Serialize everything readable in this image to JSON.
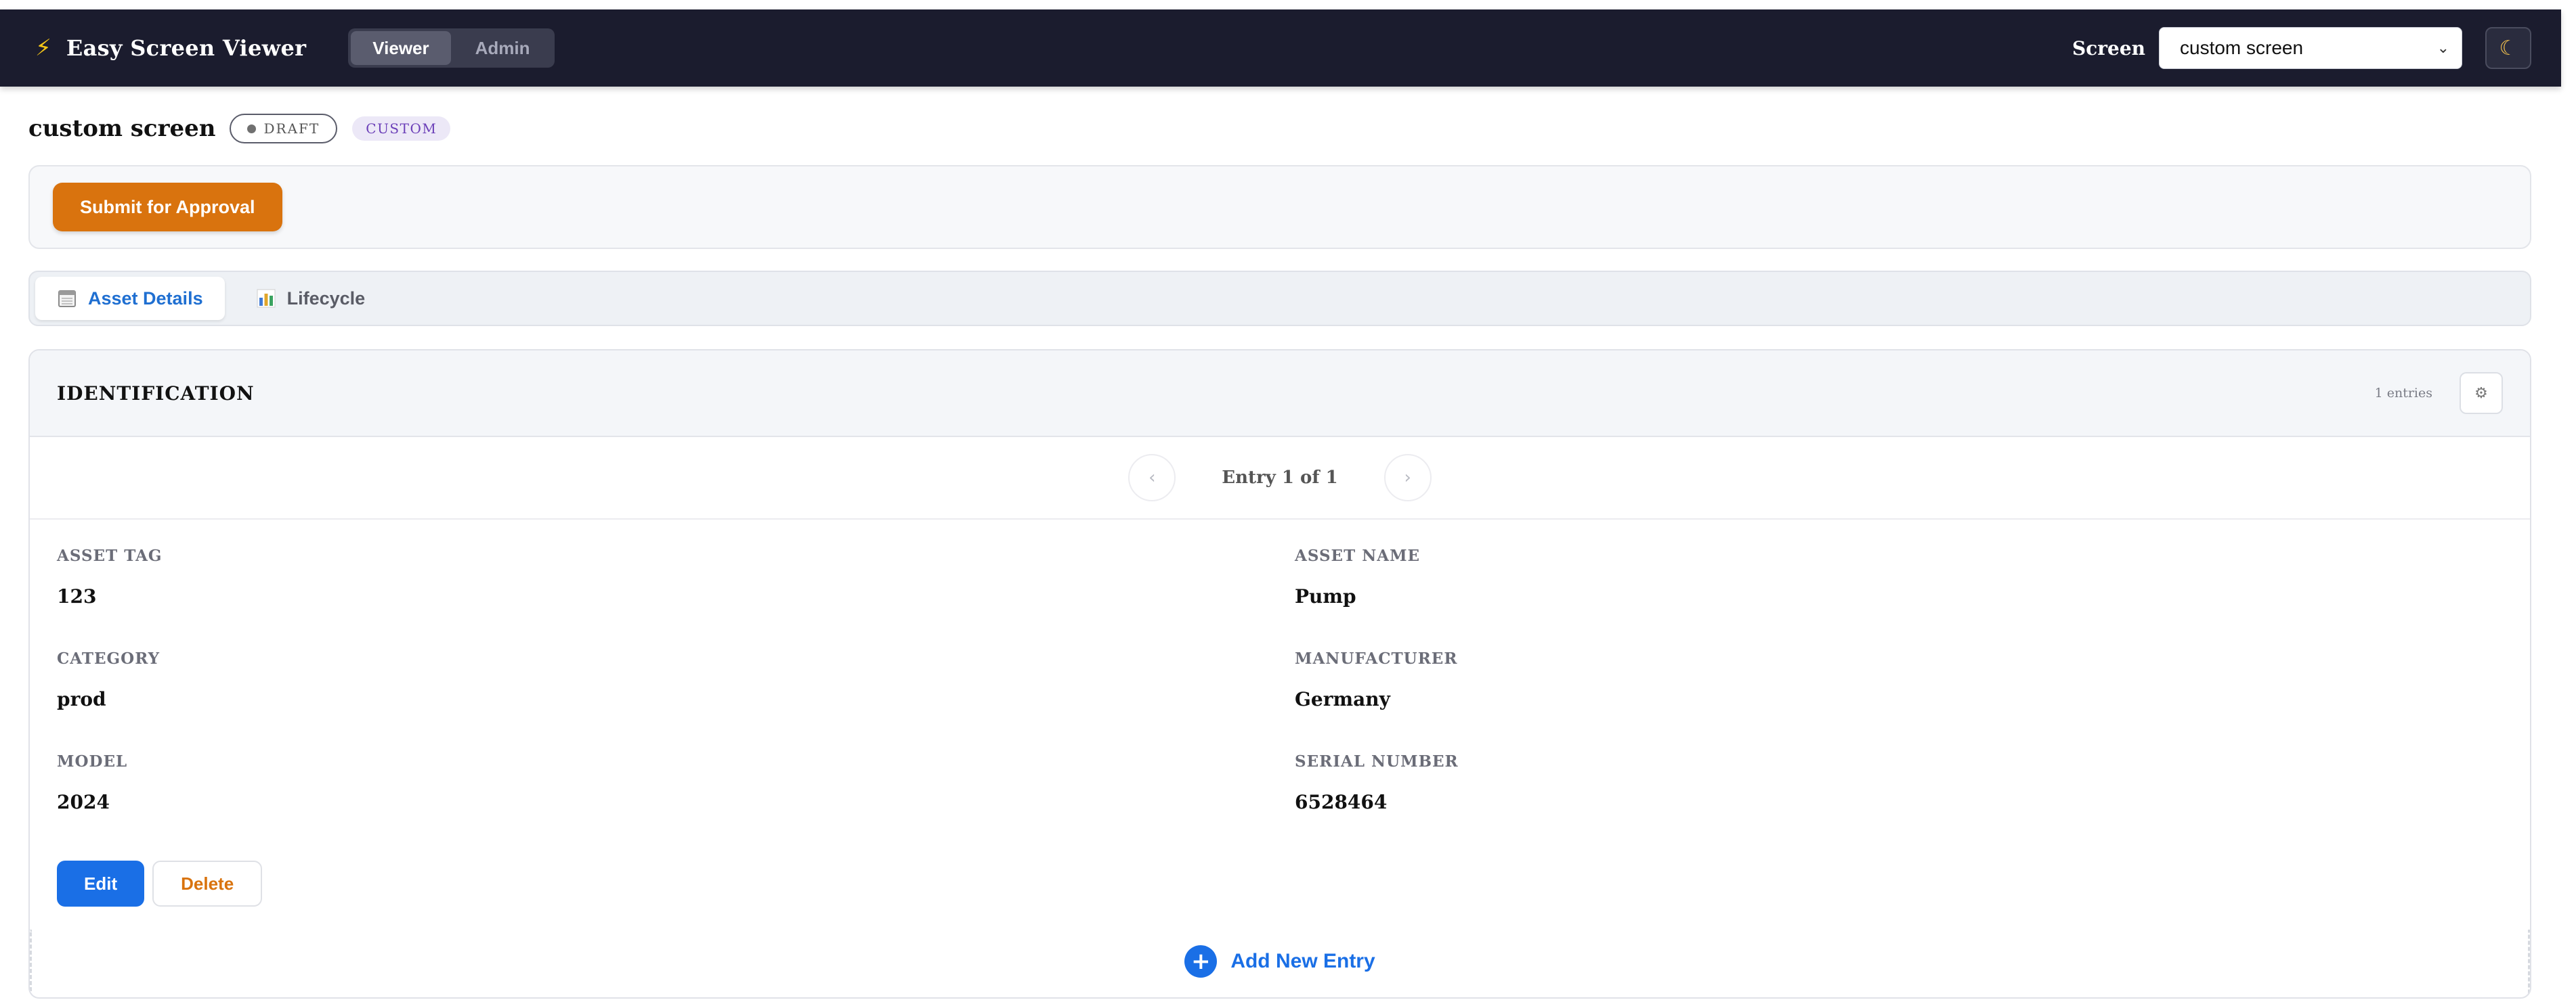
{
  "app": {
    "title": "Easy Screen Viewer",
    "brand_icon": "lightning-icon"
  },
  "mode_switch": {
    "options": [
      "Viewer",
      "Admin"
    ],
    "selected": "Viewer"
  },
  "screen_selector": {
    "label": "Screen",
    "value": "custom screen"
  },
  "theme_toggle": {
    "icon": "moon-icon"
  },
  "page": {
    "title": "custom screen",
    "status": "DRAFT",
    "type": "CUSTOM"
  },
  "actions": {
    "submit_label": "Submit for Approval"
  },
  "tabs": [
    {
      "label": "Asset Details",
      "icon": "calendar-icon",
      "active": true
    },
    {
      "label": "Lifecycle",
      "icon": "bar-chart-icon",
      "active": false
    }
  ],
  "section": {
    "title": "IDENTIFICATION",
    "entries_count": "1 entries",
    "pager_text": "Entry 1 of 1",
    "fields": [
      {
        "label": "ASSET TAG",
        "value": "123"
      },
      {
        "label": "ASSET NAME",
        "value": "Pump"
      },
      {
        "label": "CATEGORY",
        "value": "prod"
      },
      {
        "label": "MANUFACTURER",
        "value": "Germany"
      },
      {
        "label": "MODEL",
        "value": "2024"
      },
      {
        "label": "SERIAL NUMBER",
        "value": "6528464"
      }
    ],
    "edit_label": "Edit",
    "delete_label": "Delete",
    "add_label": "Add New Entry"
  },
  "colors": {
    "topbar": "#1b1c2e",
    "accent_blue": "#1a6fe6",
    "accent_orange": "#d9730e",
    "custom_badge": "#6b3fb8"
  }
}
